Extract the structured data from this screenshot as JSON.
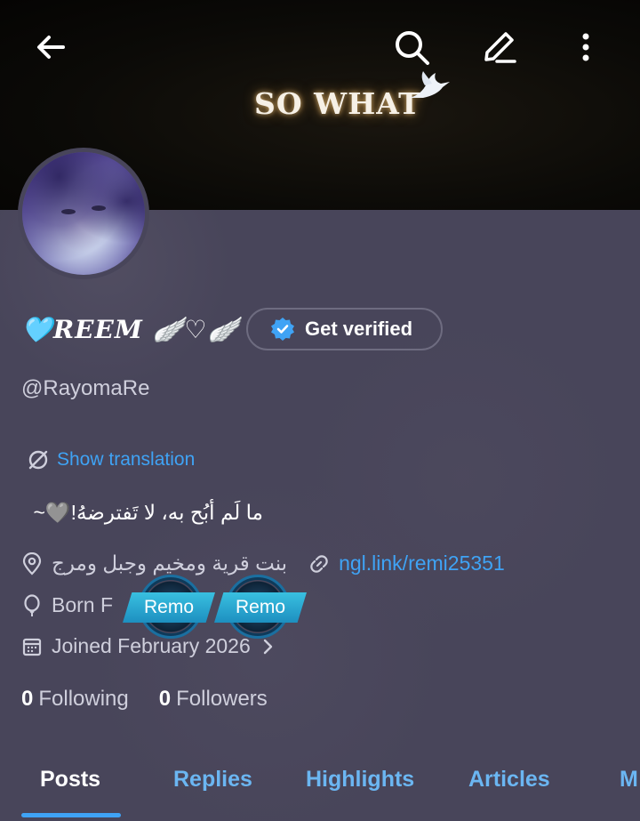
{
  "banner": {
    "text": "SO WHAT"
  },
  "profile": {
    "display_name": "🩵REEM 🪽♡🪽",
    "verify_label": "Get verified",
    "handle": "@RayomaRe",
    "translate_label": "Show translation",
    "bio": "ما لَم أبُح به، لا تَفترضهُ!🩶~",
    "location": "بنت قرية ومخيم وجبل ومرج",
    "link": "ngl.link/remi25351",
    "born": "Born F",
    "joined": "Joined February 2026",
    "badges": [
      "Remo",
      "Remo"
    ],
    "following_count": "0",
    "following_label": "Following",
    "followers_count": "0",
    "followers_label": "Followers"
  },
  "tabs": [
    "Posts",
    "Replies",
    "Highlights",
    "Articles",
    "M"
  ],
  "colors": {
    "accent": "#3fa3f5",
    "background": "#48455a"
  }
}
